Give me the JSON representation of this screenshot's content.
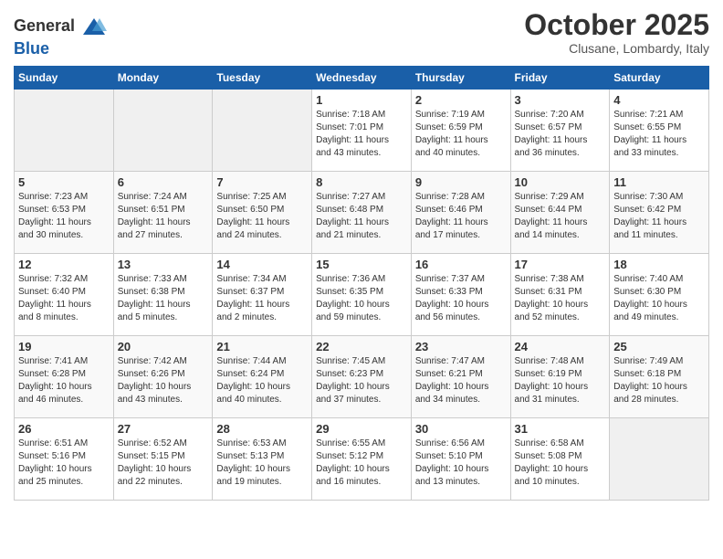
{
  "logo": {
    "general": "General",
    "blue": "Blue"
  },
  "title": "October 2025",
  "location": "Clusane, Lombardy, Italy",
  "days_of_week": [
    "Sunday",
    "Monday",
    "Tuesday",
    "Wednesday",
    "Thursday",
    "Friday",
    "Saturday"
  ],
  "weeks": [
    [
      {
        "day": "",
        "info": ""
      },
      {
        "day": "",
        "info": ""
      },
      {
        "day": "",
        "info": ""
      },
      {
        "day": "1",
        "info": "Sunrise: 7:18 AM\nSunset: 7:01 PM\nDaylight: 11 hours\nand 43 minutes."
      },
      {
        "day": "2",
        "info": "Sunrise: 7:19 AM\nSunset: 6:59 PM\nDaylight: 11 hours\nand 40 minutes."
      },
      {
        "day": "3",
        "info": "Sunrise: 7:20 AM\nSunset: 6:57 PM\nDaylight: 11 hours\nand 36 minutes."
      },
      {
        "day": "4",
        "info": "Sunrise: 7:21 AM\nSunset: 6:55 PM\nDaylight: 11 hours\nand 33 minutes."
      }
    ],
    [
      {
        "day": "5",
        "info": "Sunrise: 7:23 AM\nSunset: 6:53 PM\nDaylight: 11 hours\nand 30 minutes."
      },
      {
        "day": "6",
        "info": "Sunrise: 7:24 AM\nSunset: 6:51 PM\nDaylight: 11 hours\nand 27 minutes."
      },
      {
        "day": "7",
        "info": "Sunrise: 7:25 AM\nSunset: 6:50 PM\nDaylight: 11 hours\nand 24 minutes."
      },
      {
        "day": "8",
        "info": "Sunrise: 7:27 AM\nSunset: 6:48 PM\nDaylight: 11 hours\nand 21 minutes."
      },
      {
        "day": "9",
        "info": "Sunrise: 7:28 AM\nSunset: 6:46 PM\nDaylight: 11 hours\nand 17 minutes."
      },
      {
        "day": "10",
        "info": "Sunrise: 7:29 AM\nSunset: 6:44 PM\nDaylight: 11 hours\nand 14 minutes."
      },
      {
        "day": "11",
        "info": "Sunrise: 7:30 AM\nSunset: 6:42 PM\nDaylight: 11 hours\nand 11 minutes."
      }
    ],
    [
      {
        "day": "12",
        "info": "Sunrise: 7:32 AM\nSunset: 6:40 PM\nDaylight: 11 hours\nand 8 minutes."
      },
      {
        "day": "13",
        "info": "Sunrise: 7:33 AM\nSunset: 6:38 PM\nDaylight: 11 hours\nand 5 minutes."
      },
      {
        "day": "14",
        "info": "Sunrise: 7:34 AM\nSunset: 6:37 PM\nDaylight: 11 hours\nand 2 minutes."
      },
      {
        "day": "15",
        "info": "Sunrise: 7:36 AM\nSunset: 6:35 PM\nDaylight: 10 hours\nand 59 minutes."
      },
      {
        "day": "16",
        "info": "Sunrise: 7:37 AM\nSunset: 6:33 PM\nDaylight: 10 hours\nand 56 minutes."
      },
      {
        "day": "17",
        "info": "Sunrise: 7:38 AM\nSunset: 6:31 PM\nDaylight: 10 hours\nand 52 minutes."
      },
      {
        "day": "18",
        "info": "Sunrise: 7:40 AM\nSunset: 6:30 PM\nDaylight: 10 hours\nand 49 minutes."
      }
    ],
    [
      {
        "day": "19",
        "info": "Sunrise: 7:41 AM\nSunset: 6:28 PM\nDaylight: 10 hours\nand 46 minutes."
      },
      {
        "day": "20",
        "info": "Sunrise: 7:42 AM\nSunset: 6:26 PM\nDaylight: 10 hours\nand 43 minutes."
      },
      {
        "day": "21",
        "info": "Sunrise: 7:44 AM\nSunset: 6:24 PM\nDaylight: 10 hours\nand 40 minutes."
      },
      {
        "day": "22",
        "info": "Sunrise: 7:45 AM\nSunset: 6:23 PM\nDaylight: 10 hours\nand 37 minutes."
      },
      {
        "day": "23",
        "info": "Sunrise: 7:47 AM\nSunset: 6:21 PM\nDaylight: 10 hours\nand 34 minutes."
      },
      {
        "day": "24",
        "info": "Sunrise: 7:48 AM\nSunset: 6:19 PM\nDaylight: 10 hours\nand 31 minutes."
      },
      {
        "day": "25",
        "info": "Sunrise: 7:49 AM\nSunset: 6:18 PM\nDaylight: 10 hours\nand 28 minutes."
      }
    ],
    [
      {
        "day": "26",
        "info": "Sunrise: 6:51 AM\nSunset: 5:16 PM\nDaylight: 10 hours\nand 25 minutes."
      },
      {
        "day": "27",
        "info": "Sunrise: 6:52 AM\nSunset: 5:15 PM\nDaylight: 10 hours\nand 22 minutes."
      },
      {
        "day": "28",
        "info": "Sunrise: 6:53 AM\nSunset: 5:13 PM\nDaylight: 10 hours\nand 19 minutes."
      },
      {
        "day": "29",
        "info": "Sunrise: 6:55 AM\nSunset: 5:12 PM\nDaylight: 10 hours\nand 16 minutes."
      },
      {
        "day": "30",
        "info": "Sunrise: 6:56 AM\nSunset: 5:10 PM\nDaylight: 10 hours\nand 13 minutes."
      },
      {
        "day": "31",
        "info": "Sunrise: 6:58 AM\nSunset: 5:08 PM\nDaylight: 10 hours\nand 10 minutes."
      },
      {
        "day": "",
        "info": ""
      }
    ]
  ]
}
